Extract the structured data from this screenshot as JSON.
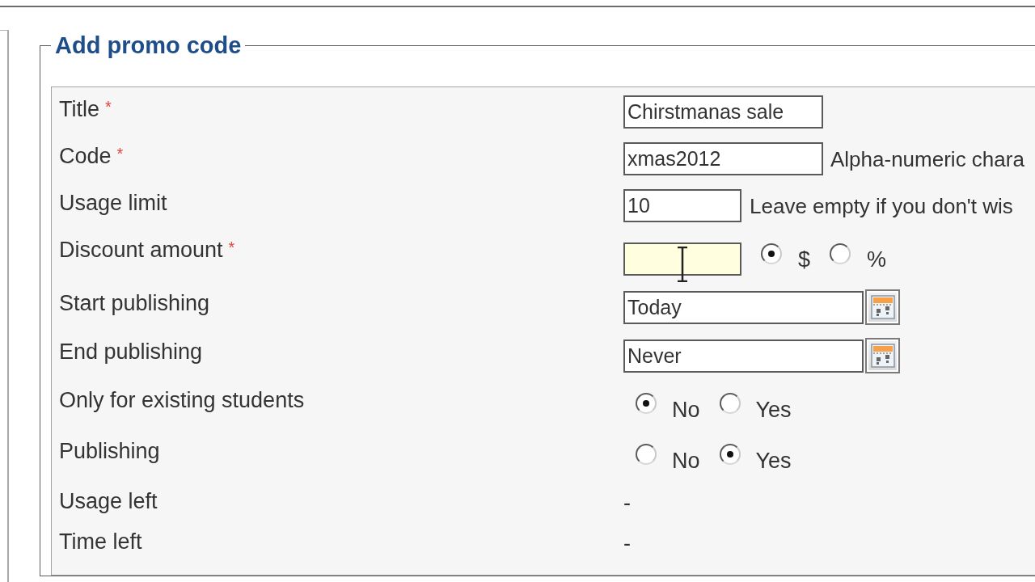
{
  "fieldset": {
    "legend": "Add promo code"
  },
  "rows": [
    {
      "kind": "text",
      "label": "Title",
      "required_mark": "*",
      "input": {
        "value": "Chirstmanas sale",
        "focused": false
      }
    },
    {
      "kind": "text",
      "label": "Code",
      "required_mark": "*",
      "input": {
        "value": "xmas2012",
        "focused": false
      },
      "hint": "Alpha-numeric chara"
    },
    {
      "kind": "number",
      "label": "Usage limit",
      "input": {
        "value": "10",
        "focused": false
      },
      "hint": "Leave empty if you don't wis"
    },
    {
      "kind": "amount",
      "label": "Discount amount",
      "required_mark": "*",
      "input": {
        "focused": true
      },
      "options": [
        {
          "label": "$",
          "selected": true
        },
        {
          "label": "%",
          "selected": false
        }
      ]
    },
    {
      "kind": "date",
      "label": "Start publishing",
      "input": {
        "value": "Today",
        "focused": false
      }
    },
    {
      "kind": "date",
      "label": "End publishing",
      "input": {
        "value": "Never",
        "focused": false
      }
    },
    {
      "kind": "choice",
      "label": "Only for existing students",
      "options": [
        {
          "label": "No",
          "selected": true
        },
        {
          "label": "Yes",
          "selected": false
        }
      ]
    },
    {
      "kind": "choice",
      "label": "Publishing",
      "options": [
        {
          "label": "No",
          "selected": false
        },
        {
          "label": "Yes",
          "selected": true
        }
      ]
    },
    {
      "kind": "info",
      "label": "Usage left",
      "value": "-"
    },
    {
      "kind": "info",
      "label": "Time left",
      "value": "-"
    }
  ]
}
